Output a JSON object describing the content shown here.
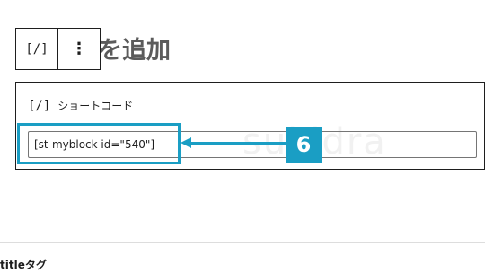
{
  "page": {
    "title": "ルを追加"
  },
  "watermark": {
    "text": "sukidra"
  },
  "toolbar": {
    "shortcode_icon": "[/]",
    "more_icon": "⋮"
  },
  "shortcode_block": {
    "icon": "[/]",
    "label": "ショートコード",
    "input_value": "[st-myblock id=\"540\"]"
  },
  "annotation": {
    "step_number": "6",
    "color": "#1a9ec4"
  },
  "sidebar_section": {
    "label": "titleタグ"
  }
}
